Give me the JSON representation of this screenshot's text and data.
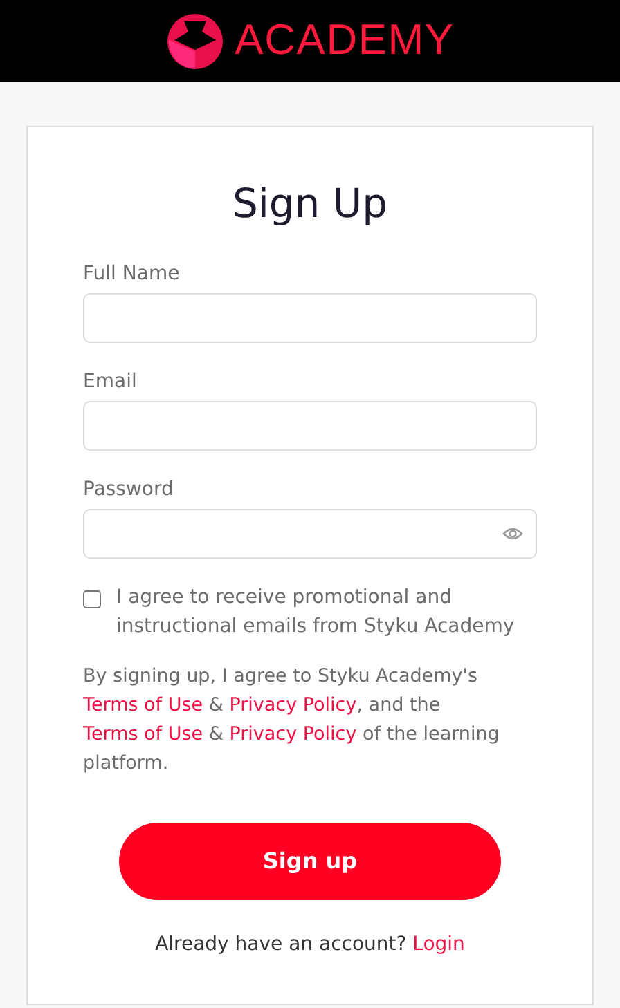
{
  "header": {
    "brand": "ACADEMY"
  },
  "form": {
    "title": "Sign Up",
    "fields": [
      {
        "label": "Full Name",
        "kind": "text"
      },
      {
        "label": "Email",
        "kind": "text"
      },
      {
        "label": "Password",
        "kind": "password"
      }
    ],
    "consent": {
      "checked": false,
      "text": "I agree to receive promotional and instructional emails from Styku Academy"
    },
    "legal": [
      {
        "kind": "text",
        "text": "By signing up, I agree to Styku Academy's "
      },
      {
        "kind": "link",
        "text": "Terms of Use"
      },
      {
        "kind": "text",
        "text": " & "
      },
      {
        "kind": "link",
        "text": "Privacy Policy"
      },
      {
        "kind": "text",
        "text": ", and the "
      },
      {
        "kind": "link",
        "text": "Terms of Use"
      },
      {
        "kind": "text",
        "text": " & "
      },
      {
        "kind": "link",
        "text": "Privacy Policy"
      },
      {
        "kind": "text",
        "text": " of the learning platform."
      }
    ],
    "submit": "Sign up",
    "footer": [
      {
        "kind": "text",
        "text": "Already have an account? "
      },
      {
        "kind": "link",
        "text": "Login"
      }
    ]
  }
}
